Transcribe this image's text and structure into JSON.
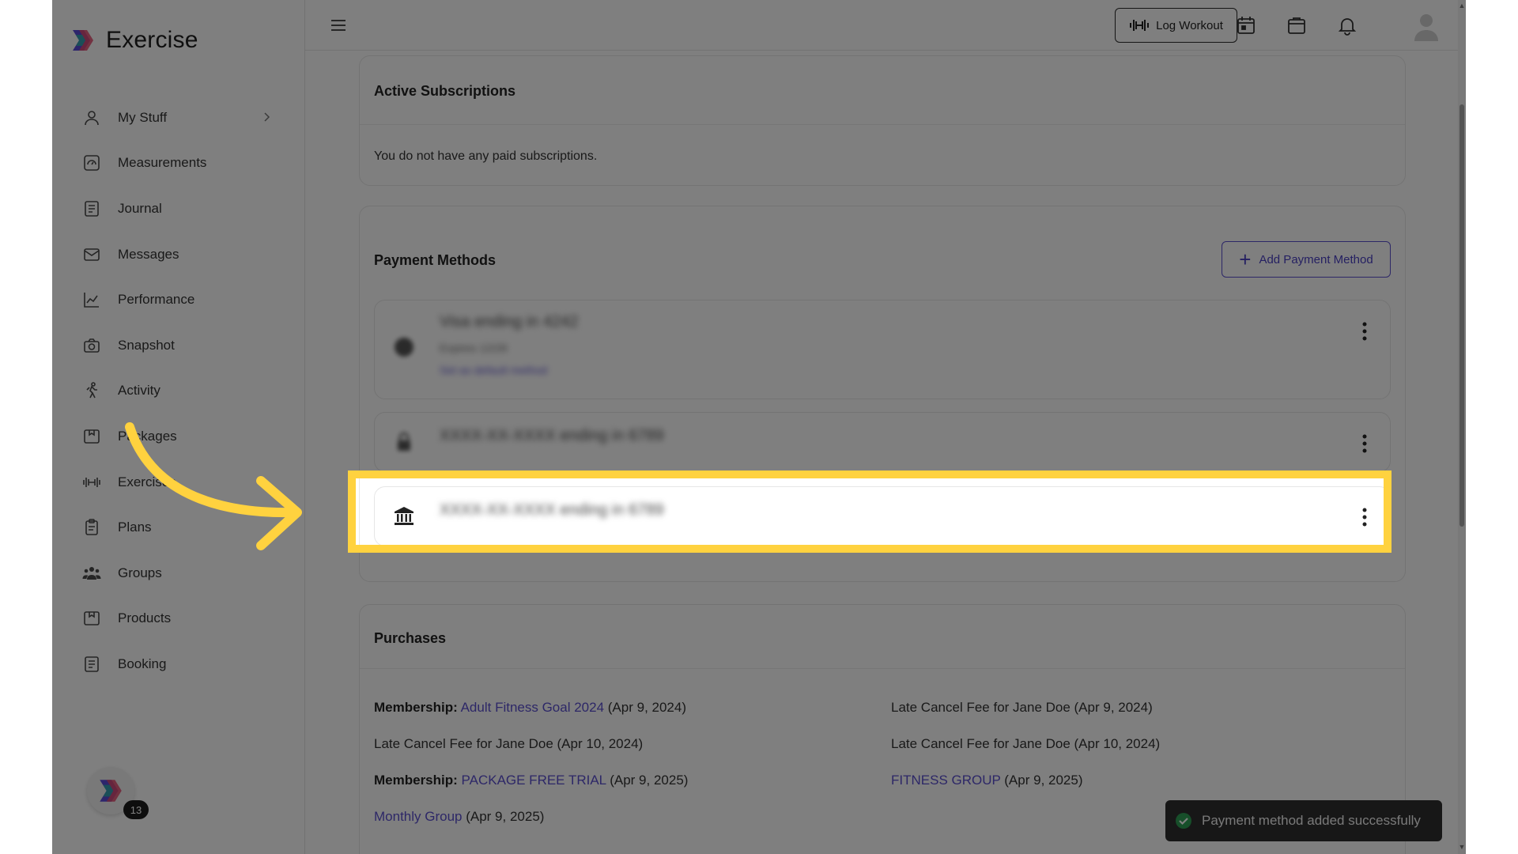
{
  "app": {
    "brand_name": "Exercise",
    "badge_count": "13"
  },
  "sidebar": {
    "items": [
      {
        "label": "My Stuff",
        "icon": "user-icon",
        "has_chevron": true
      },
      {
        "label": "Measurements",
        "icon": "measurements-icon"
      },
      {
        "label": "Journal",
        "icon": "journal-icon"
      },
      {
        "label": "Messages",
        "icon": "mail-icon"
      },
      {
        "label": "Performance",
        "icon": "chart-icon"
      },
      {
        "label": "Snapshot",
        "icon": "camera-icon"
      },
      {
        "label": "Activity",
        "icon": "running-icon"
      },
      {
        "label": "Packages",
        "icon": "package-icon"
      },
      {
        "label": "Exercises",
        "icon": "dumbbell-icon"
      },
      {
        "label": "Plans",
        "icon": "clipboard-icon"
      },
      {
        "label": "Groups",
        "icon": "group-icon"
      },
      {
        "label": "Products",
        "icon": "product-icon"
      },
      {
        "label": "Booking",
        "icon": "booking-icon"
      }
    ]
  },
  "topbar": {
    "log_workout_label": "Log Workout"
  },
  "subscriptions": {
    "title": "Active Subscriptions",
    "empty_text": "You do not have any paid subscriptions."
  },
  "payment_methods": {
    "title": "Payment Methods",
    "add_label": "Add Payment Method",
    "items": [
      {
        "line1": "Visa ending in 4242",
        "line2": "Expires 12/28",
        "line3": "Set as default method"
      },
      {
        "line1": "XXXX-XX-XXXX ending in 6789"
      },
      {
        "line1": "XXXX-XX-XXXX ending in 6789",
        "icon": "bank-icon"
      }
    ]
  },
  "purchases": {
    "title": "Purchases",
    "rows": [
      {
        "prefix": "Membership:",
        "link": "Adult Fitness Goal 2024",
        "suffix": " (Apr 9, 2024)"
      },
      {
        "prefix": "",
        "link": "",
        "suffix": "Late Cancel Fee for Jane Doe (Apr 9, 2024)"
      },
      {
        "prefix": "",
        "link": "",
        "suffix": "Late Cancel Fee for Jane Doe (Apr 10, 2024)"
      },
      {
        "prefix": "",
        "link": "",
        "suffix": "Late Cancel Fee for Jane Doe (Apr 10, 2024)"
      },
      {
        "prefix": "Membership:",
        "link": "PACKAGE FREE TRIAL",
        "suffix": " (Apr 9, 2025)"
      },
      {
        "prefix": "",
        "link": "FITNESS GROUP",
        "suffix": " (Apr 9, 2025)"
      },
      {
        "prefix": "",
        "link": "Monthly Group",
        "suffix": " (Apr 9, 2025)"
      }
    ]
  },
  "toast": {
    "message": "Payment method added successfully"
  },
  "colors": {
    "accent": "#5a4fcf",
    "highlight": "#ffd23f",
    "toast_bg": "#2e2e2e",
    "success": "#2f9e55"
  }
}
